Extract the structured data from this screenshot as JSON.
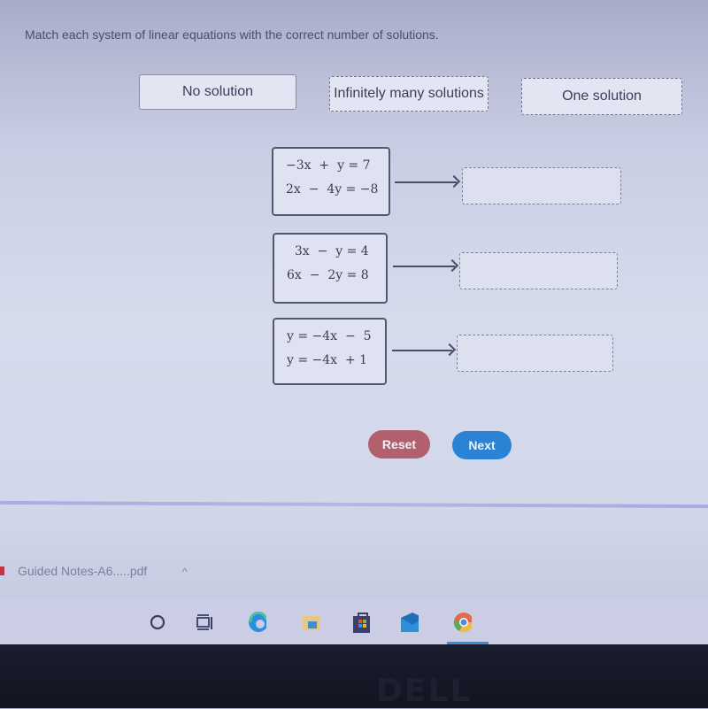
{
  "instruction": "Match each system of linear equations with the correct number of solutions.",
  "answer_tiles": [
    {
      "label": "No solution"
    },
    {
      "label": "Infinitely many solutions"
    },
    {
      "label": "One solution"
    }
  ],
  "systems": [
    {
      "eq1": "−3x  +  y = 7",
      "eq2": "2x  −  4y = −8",
      "answer": ""
    },
    {
      "eq1": "  3x  −  y = 4",
      "eq2": "6x  −  2y = 8",
      "answer": ""
    },
    {
      "eq1": "y = −4x  −  5",
      "eq2": "y = −4x  + 1",
      "answer": ""
    }
  ],
  "buttons": {
    "reset": "Reset",
    "next": "Next"
  },
  "colors": {
    "reset": "#b3606e",
    "next": "#2a83d4"
  },
  "download_bar": {
    "filename": "Guided Notes-A6.....pdf",
    "chevron": "^"
  },
  "taskbar": {
    "icons": [
      "search-circle-icon",
      "task-view-icon",
      "edge-icon",
      "file-explorer-icon",
      "store-icon",
      "mail-icon",
      "chrome-icon"
    ]
  },
  "bezel_logo": "DELL"
}
